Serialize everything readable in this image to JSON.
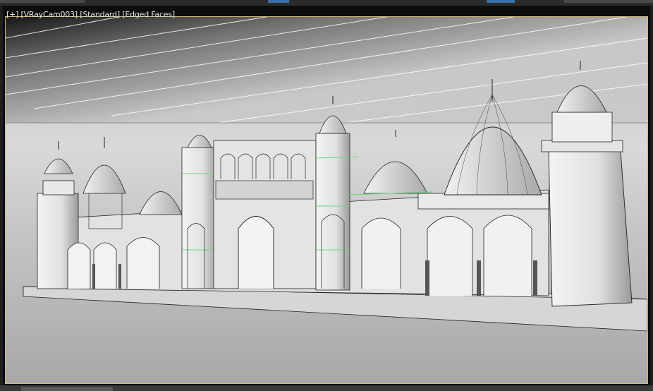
{
  "viewport": {
    "label_plus": "[+]",
    "label_camera": "[VRayCam003]",
    "label_shading": "[Standard]",
    "label_mode": "[Edged Faces]"
  },
  "colors": {
    "frame_border": "#c9b67a",
    "viewport_bg": "#0d0d0d",
    "model_fill": "#e6e6e6",
    "edge": "#1a1a1a",
    "selection_edge": "#6fd37a"
  }
}
